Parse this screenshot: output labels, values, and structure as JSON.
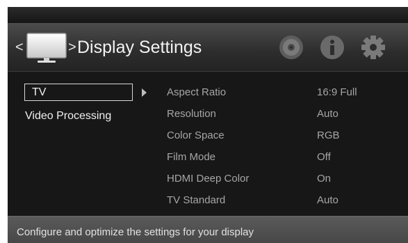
{
  "header": {
    "prev_glyph": "<",
    "next_glyph": ">",
    "title": "Display Settings",
    "icons": [
      "tv-icon",
      "disc-icon",
      "info-icon",
      "gear-icon"
    ]
  },
  "categories": [
    {
      "label": "TV",
      "selected": true
    },
    {
      "label": "Video Processing",
      "selected": false
    }
  ],
  "settings": [
    {
      "label": "Aspect Ratio",
      "value": "16:9 Full"
    },
    {
      "label": "Resolution",
      "value": "Auto"
    },
    {
      "label": "Color Space",
      "value": "RGB"
    },
    {
      "label": "Film Mode",
      "value": "Off"
    },
    {
      "label": "HDMI Deep Color",
      "value": "On"
    },
    {
      "label": "TV Standard",
      "value": "Auto"
    }
  ],
  "footer": {
    "help_text": "Configure and optimize the settings for your display"
  },
  "colors": {
    "background": "#1a1a1a",
    "header": "#3a3a3a",
    "footer": "#505050",
    "setting_text": "#a6a6a6",
    "category_text": "#f0f0f0"
  }
}
